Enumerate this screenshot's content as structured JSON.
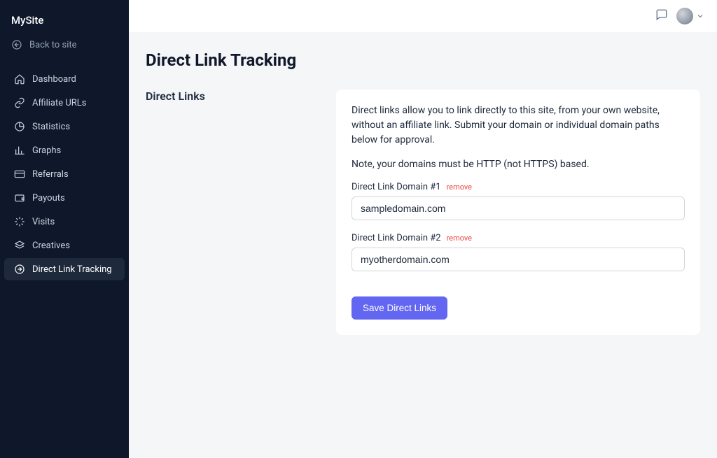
{
  "sidebar": {
    "site_title": "MySite",
    "back_label": "Back to site",
    "items": [
      {
        "label": "Dashboard"
      },
      {
        "label": "Affiliate URLs"
      },
      {
        "label": "Statistics"
      },
      {
        "label": "Graphs"
      },
      {
        "label": "Referrals"
      },
      {
        "label": "Payouts"
      },
      {
        "label": "Visits"
      },
      {
        "label": "Creatives"
      },
      {
        "label": "Direct Link Tracking"
      }
    ]
  },
  "page": {
    "title": "Direct Link Tracking",
    "section_heading": "Direct Links"
  },
  "panel": {
    "intro": "Direct links allow you to link directly to this site, from your own website, without an affiliate link. Submit your domain or individual domain paths below for approval.",
    "note": "Note, your domains must be HTTP (not HTTPS) based.",
    "domains": [
      {
        "label": "Direct Link Domain #1",
        "remove": "remove",
        "value": "sampledomain.com"
      },
      {
        "label": "Direct Link Domain #2",
        "remove": "remove",
        "value": "myotherdomain.com"
      }
    ],
    "save_label": "Save Direct Links"
  }
}
